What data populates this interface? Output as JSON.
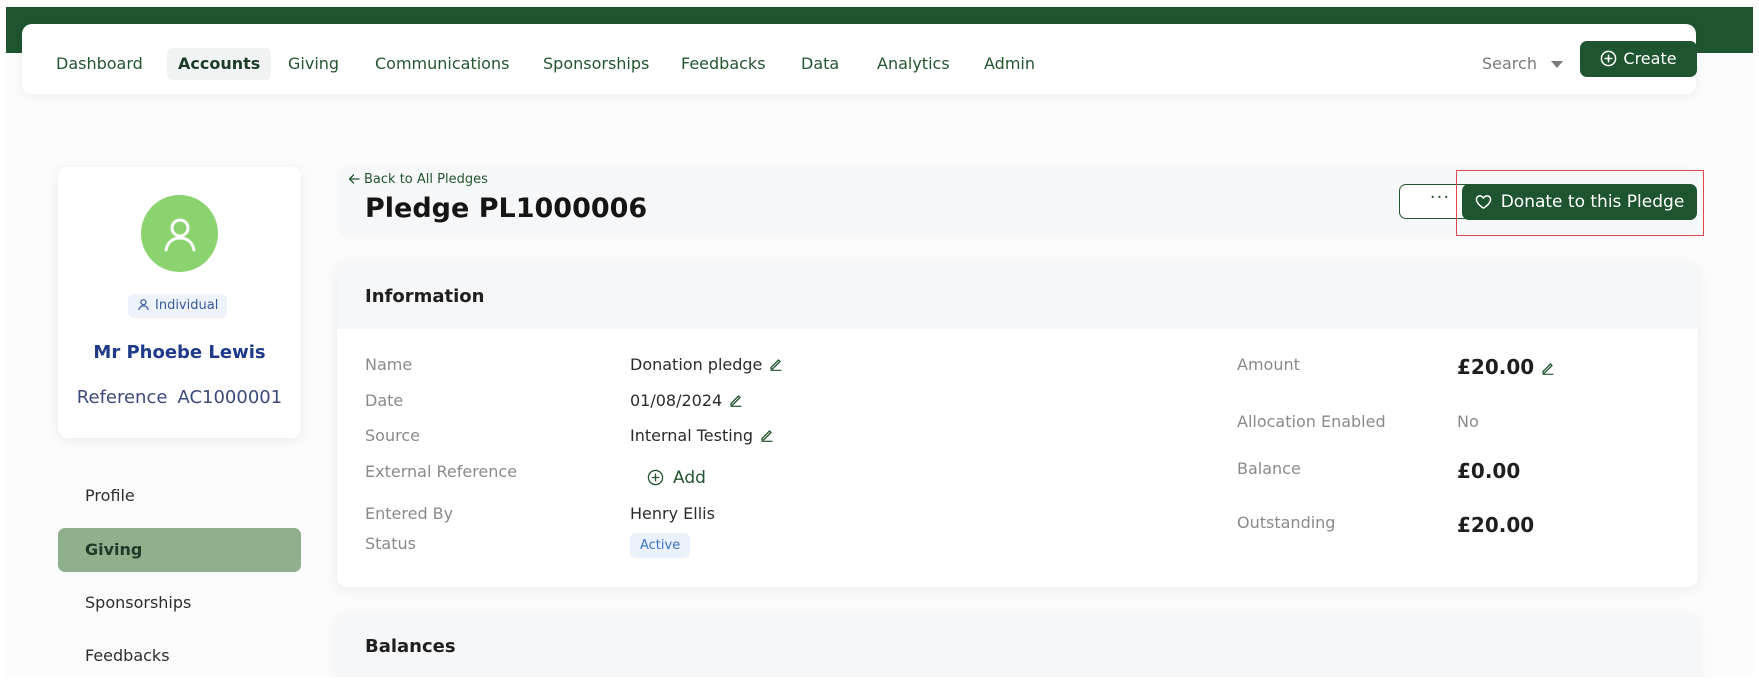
{
  "nav": {
    "items": [
      {
        "label": "Dashboard",
        "active": false
      },
      {
        "label": "Accounts",
        "active": true
      },
      {
        "label": "Giving",
        "active": false
      },
      {
        "label": "Communications",
        "active": false
      },
      {
        "label": "Sponsorships",
        "active": false
      },
      {
        "label": "Feedbacks",
        "active": false
      },
      {
        "label": "Data",
        "active": false
      },
      {
        "label": "Analytics",
        "active": false
      },
      {
        "label": "Admin",
        "active": false
      }
    ],
    "search_label": "Search",
    "create_label": "Create"
  },
  "profile": {
    "type_badge": "Individual",
    "name": "Mr Phoebe Lewis",
    "reference_label": "Reference",
    "reference_value": "AC1000001"
  },
  "left_nav": {
    "items": [
      {
        "label": "Profile",
        "active": false
      },
      {
        "label": "Giving",
        "active": true
      },
      {
        "label": "Sponsorships",
        "active": false
      },
      {
        "label": "Feedbacks",
        "active": false
      }
    ]
  },
  "header": {
    "back_label": "Back to All Pledges",
    "title": "Pledge PL1000006",
    "more_label": "···",
    "donate_label": "Donate to this Pledge"
  },
  "information": {
    "title": "Information",
    "name_label": "Name",
    "name_value": "Donation pledge",
    "date_label": "Date",
    "date_value": "01/08/2024",
    "source_label": "Source",
    "source_value": "Internal Testing",
    "external_ref_label": "External Reference",
    "external_ref_add": "Add",
    "entered_by_label": "Entered By",
    "entered_by_value": "Henry Ellis",
    "status_label": "Status",
    "status_value": "Active",
    "amount_label": "Amount",
    "amount_value": "£20.00",
    "allocation_label": "Allocation Enabled",
    "allocation_value": "No",
    "balance_label": "Balance",
    "balance_value": "£0.00",
    "outstanding_label": "Outstanding",
    "outstanding_value": "£20.00"
  },
  "balances": {
    "title": "Balances"
  },
  "colors": {
    "brand_green": "#1e5530",
    "active_side": "#8faf8d",
    "avatar": "#8bd36e",
    "highlight": "#e0484b"
  }
}
